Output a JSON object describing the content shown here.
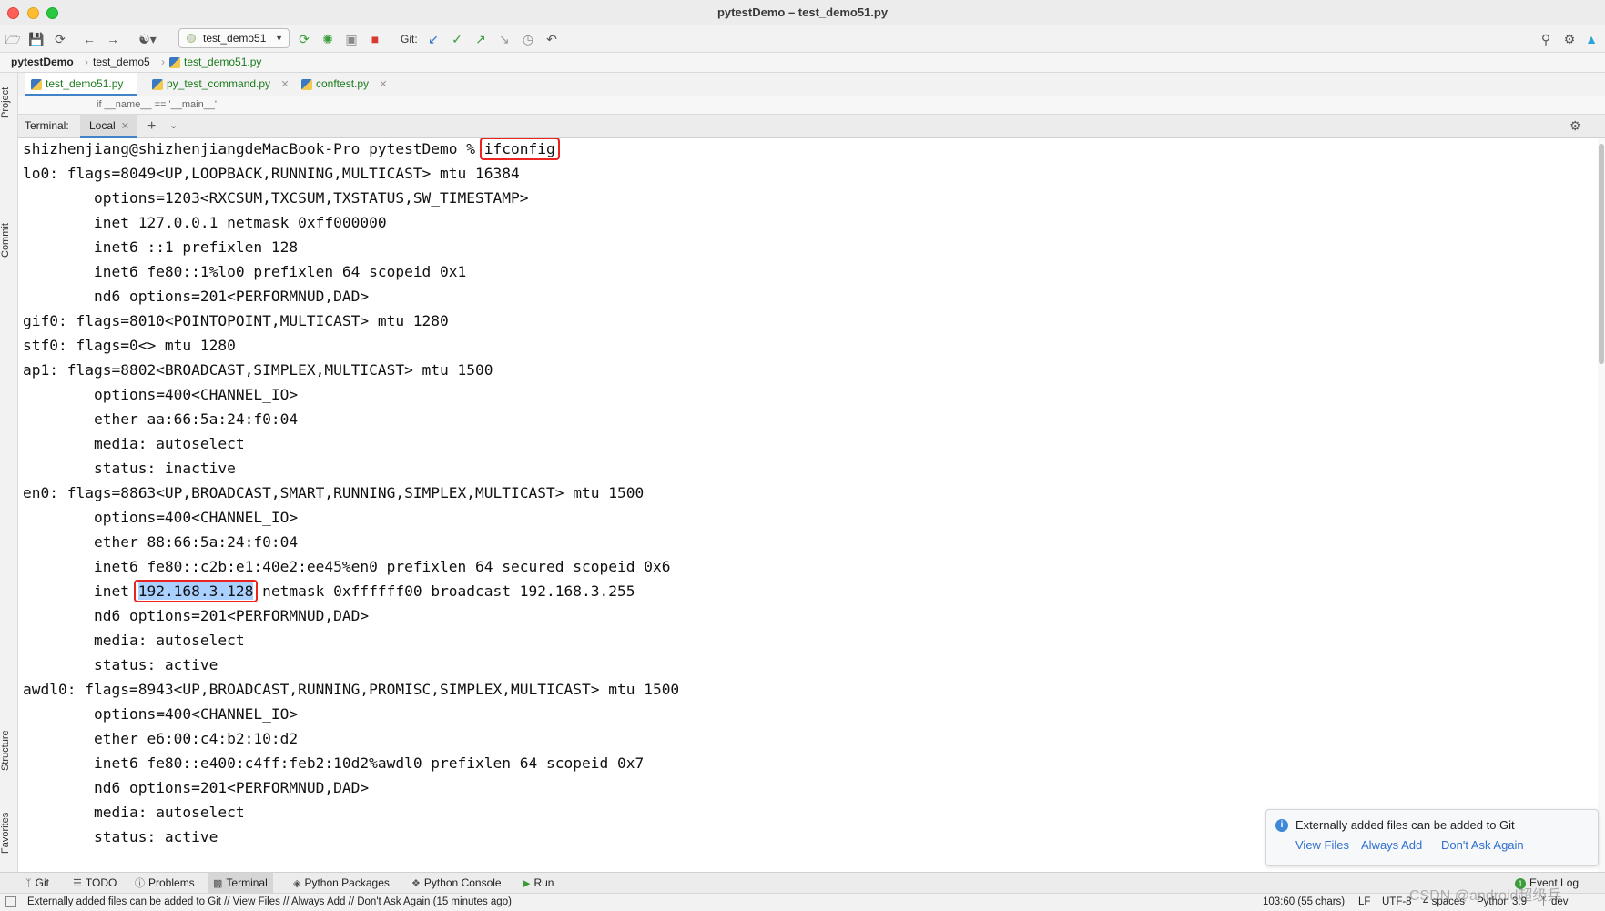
{
  "window": {
    "title": "pytestDemo – test_demo51.py"
  },
  "toolbar": {
    "run_config": "test_demo51",
    "git_label": "Git:",
    "icons": [
      "open-folder-icon",
      "save-icon",
      "sync-icon",
      "back-icon",
      "forward-icon",
      "user-icon",
      "rerun-icon",
      "debug-icon",
      "coverage-icon",
      "stop-icon",
      "git-update-icon",
      "git-commit-icon",
      "git-push-icon",
      "git-fetch-icon",
      "history-icon",
      "rollback-icon",
      "search-icon",
      "gear-icon",
      "jetbrains-icon"
    ]
  },
  "breadcrumb": {
    "project": "pytestDemo",
    "folder": "test_demo5",
    "file": "test_demo51.py"
  },
  "left_strip": {
    "project": "Project",
    "commit": "Commit",
    "structure": "Structure",
    "favorites": "Favorites"
  },
  "tabs": [
    {
      "label": "test_demo51.py"
    },
    {
      "label": "py_test_command.py"
    },
    {
      "label": "conftest.py"
    }
  ],
  "code_hint": "if __name__ == '__main__'",
  "terminal_panel": {
    "label": "Terminal:",
    "tab": "Local"
  },
  "terminal": {
    "prompt": "shizhenjiang@shizhenjiangdeMacBook-Pro pytestDemo % ",
    "command": "ifconfig",
    "lines": [
      "lo0: flags=8049<UP,LOOPBACK,RUNNING,MULTICAST> mtu 16384",
      "\toptions=1203<RXCSUM,TXCSUM,TXSTATUS,SW_TIMESTAMP>",
      "\tinet 127.0.0.1 netmask 0xff000000",
      "\tinet6 ::1 prefixlen 128",
      "\tinet6 fe80::1%lo0 prefixlen 64 scopeid 0x1",
      "\tnd6 options=201<PERFORMNUD,DAD>",
      "gif0: flags=8010<POINTOPOINT,MULTICAST> mtu 1280",
      "stf0: flags=0<> mtu 1280",
      "ap1: flags=8802<BROADCAST,SIMPLEX,MULTICAST> mtu 1500",
      "\toptions=400<CHANNEL_IO>",
      "\tether aa:66:5a:24:f0:04",
      "\tmedia: autoselect",
      "\tstatus: inactive",
      "en0: flags=8863<UP,BROADCAST,SMART,RUNNING,SIMPLEX,MULTICAST> mtu 1500",
      "\toptions=400<CHANNEL_IO>",
      "\tether 88:66:5a:24:f0:04",
      "\tinet6 fe80::c2b:e1:40e2:ee45%en0 prefixlen 64 secured scopeid 0x6",
      "\tnd6 options=201<PERFORMNUD,DAD>",
      "\tmedia: autoselect",
      "\tstatus: active",
      "awdl0: flags=8943<UP,BROADCAST,RUNNING,PROMISC,SIMPLEX,MULTICAST> mtu 1500",
      "\toptions=400<CHANNEL_IO>",
      "\tether e6:00:c4:b2:10:d2",
      "\tinet6 fe80::e400:c4ff:feb2:10d2%awdl0 prefixlen 64 scopeid 0x7",
      "\tnd6 options=201<PERFORMNUD,DAD>",
      "\tmedia: autoselect",
      "\tstatus: active"
    ],
    "inet_line": {
      "prefix": "        inet ",
      "ip": "192.168.3.128",
      "suffix": " netmask 0xffffff00 broadcast 192.168.3.255"
    }
  },
  "notification": {
    "message": "Externally added files can be added to Git",
    "actions": [
      "View Files",
      "Always Add",
      "Don't Ask Again"
    ]
  },
  "bottom_tabs": [
    "Git",
    "TODO",
    "Problems",
    "Terminal",
    "Python Packages",
    "Python Console",
    "Run"
  ],
  "event_log": "Event Log",
  "event_count": "1",
  "status": {
    "message": "Externally added files can be added to Git // View Files // Always Add // Don't Ask Again (15 minutes ago)",
    "position": "103:60 (55 chars)",
    "line_ending": "LF",
    "encoding": "UTF-8",
    "indent": "4 spaces",
    "interpreter": "Python 3.9",
    "branch": "dev"
  },
  "watermark": "CSDN @android超级兵",
  "colors": {
    "highlight_box": "#e8251e",
    "selection": "#a9d0ff",
    "accent": "#4083c9"
  }
}
